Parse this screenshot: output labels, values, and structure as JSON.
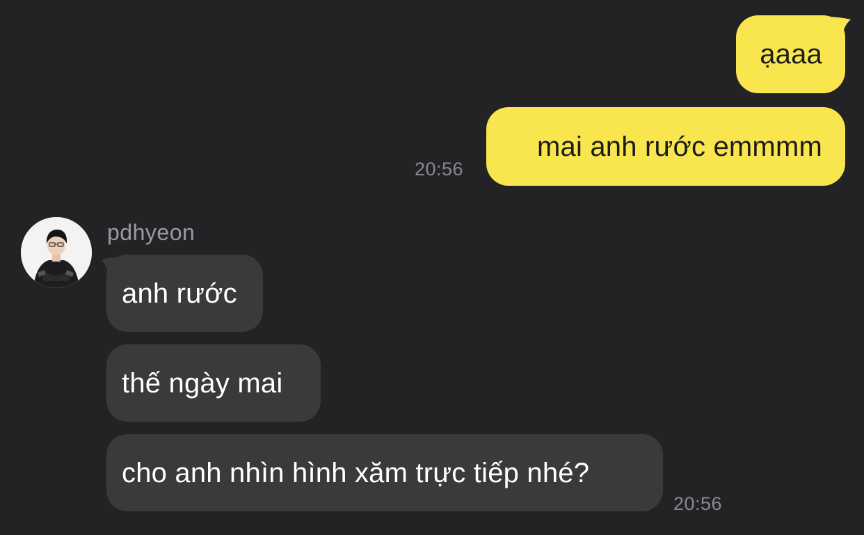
{
  "chat": {
    "outgoing": [
      {
        "text": "ạaaa"
      },
      {
        "text": "mai anh rước emmmm",
        "time": "20:56"
      }
    ],
    "incoming": {
      "sender": "pdhyeon",
      "messages": [
        {
          "text": "anh rước"
        },
        {
          "text": "thế ngày mai"
        },
        {
          "text": "cho anh nhìn hình xăm trực tiếp nhé?",
          "time": "20:56"
        }
      ]
    }
  },
  "colors": {
    "background": "#232325",
    "outgoing_bubble": "#f9e54d",
    "incoming_bubble": "#3a3a3c",
    "timestamp": "#8a8a8e"
  },
  "icons": {
    "avatar": "profile-photo-person-in-black-jacket"
  }
}
